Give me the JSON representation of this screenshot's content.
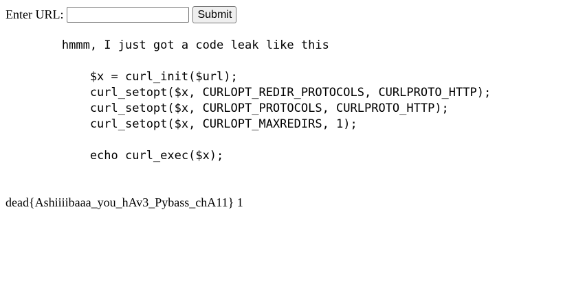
{
  "form": {
    "label": "Enter URL:",
    "url_value": "",
    "url_placeholder": "",
    "submit_label": "Submit"
  },
  "code": {
    "lines": [
      "        hmmm, I just got a code leak like this",
      "",
      "            $x = curl_init($url);",
      "            curl_setopt($x, CURLOPT_REDIR_PROTOCOLS, CURLPROTO_HTTP);",
      "            curl_setopt($x, CURLOPT_PROTOCOLS, CURLPROTO_HTTP);",
      "            curl_setopt($x, CURLOPT_MAXREDIRS, 1);",
      "",
      "            echo curl_exec($x);"
    ]
  },
  "result": {
    "text": "dead{Ashiiiibaaa_you_hAv3_Pybass_chA11} 1"
  }
}
